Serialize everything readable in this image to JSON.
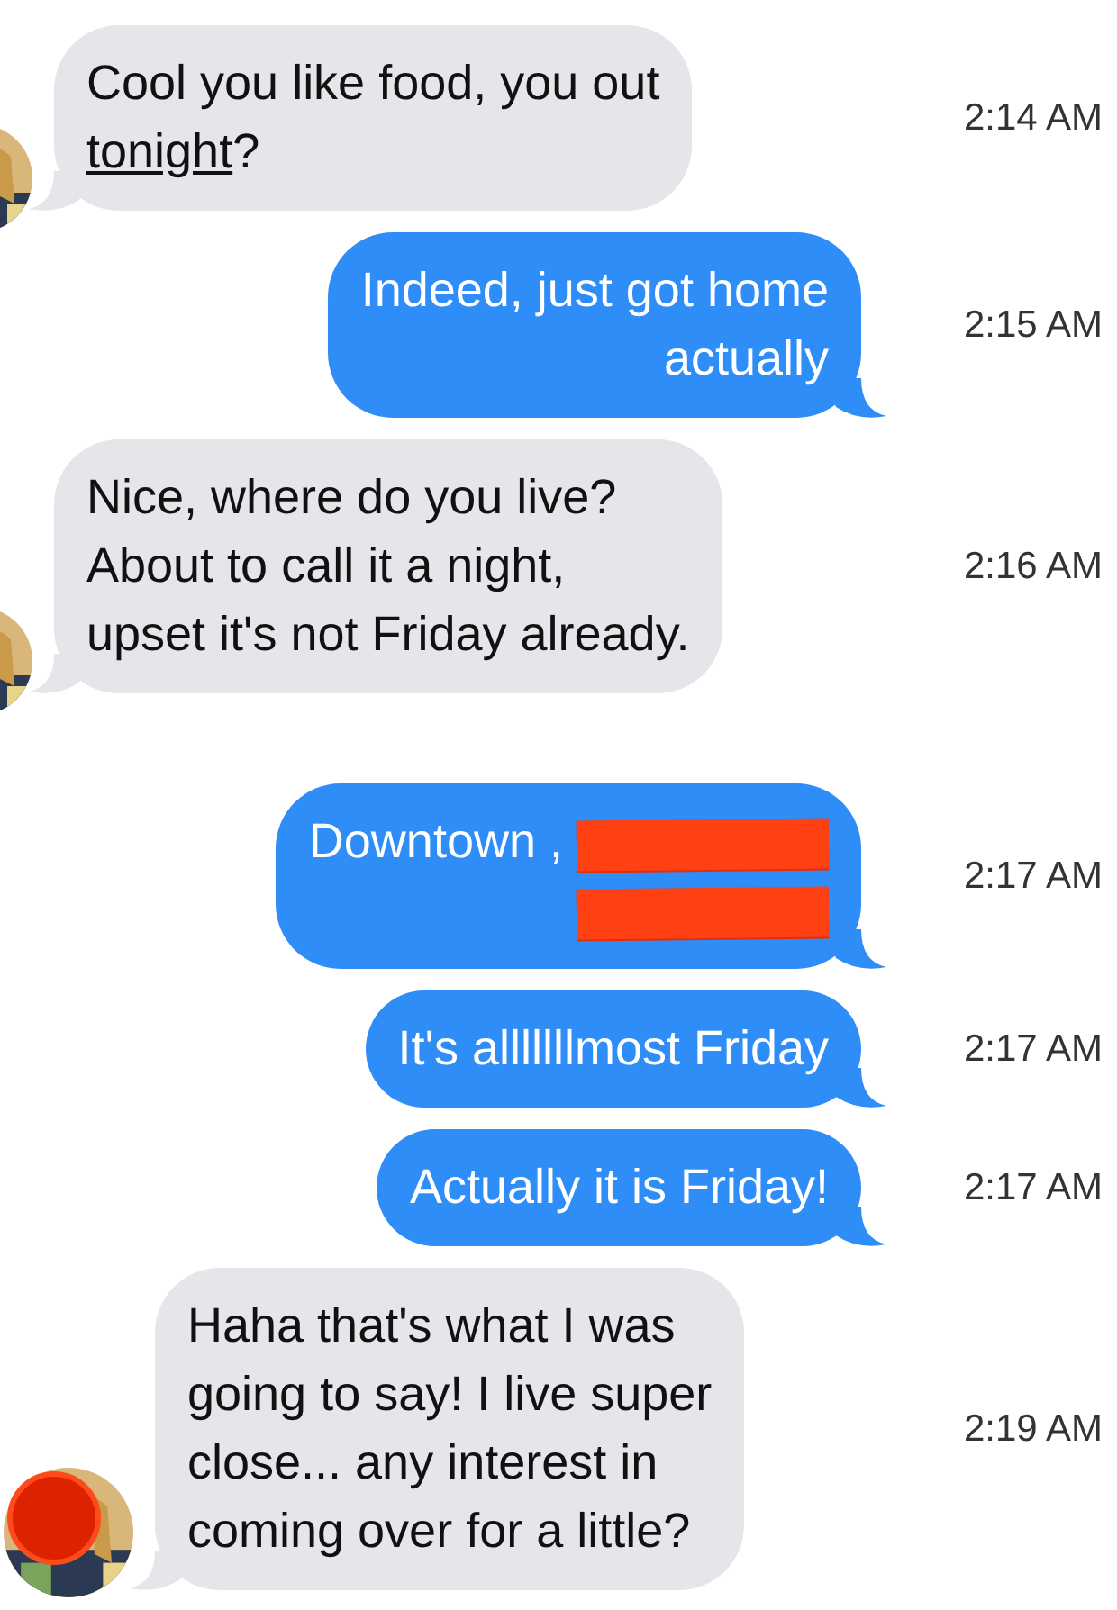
{
  "messages": [
    {
      "kind": "received",
      "time": "2:14 AM",
      "parts": [
        {
          "kind": "text",
          "text": "Cool you like food, you out\n"
        },
        {
          "kind": "link",
          "text": "tonight"
        },
        {
          "kind": "text",
          "text": "?"
        }
      ]
    },
    {
      "kind": "sent",
      "time": "2:15 AM",
      "parts": [
        {
          "kind": "text",
          "text": "Indeed, just got home\nactually"
        }
      ]
    },
    {
      "kind": "received",
      "time": "2:16 AM",
      "parts": [
        {
          "kind": "text",
          "text": "Nice, where do you live?\nAbout to call it a night,\nupset it's not Friday already."
        }
      ]
    },
    {
      "kind": "sent",
      "time": "2:17 AM",
      "parts": [
        {
          "kind": "text",
          "text": "Downtown , "
        },
        {
          "kind": "redaction"
        },
        {
          "kind": "break"
        },
        {
          "kind": "redaction"
        }
      ]
    },
    {
      "kind": "sent",
      "time": "2:17 AM",
      "parts": [
        {
          "kind": "text",
          "text": "It's alllllllmost Friday"
        }
      ]
    },
    {
      "kind": "sent",
      "time": "2:17 AM",
      "parts": [
        {
          "kind": "text",
          "text": "Actually it is Friday!"
        }
      ]
    },
    {
      "kind": "received",
      "color": "#dd2200",
      "time": "2:19 AM",
      "parts": [
        {
          "kind": "text",
          "text": "Haha that's what I was\ngoing to say! I live super\nclose... any interest in\ncoming over for a little?"
        }
      ]
    }
  ]
}
